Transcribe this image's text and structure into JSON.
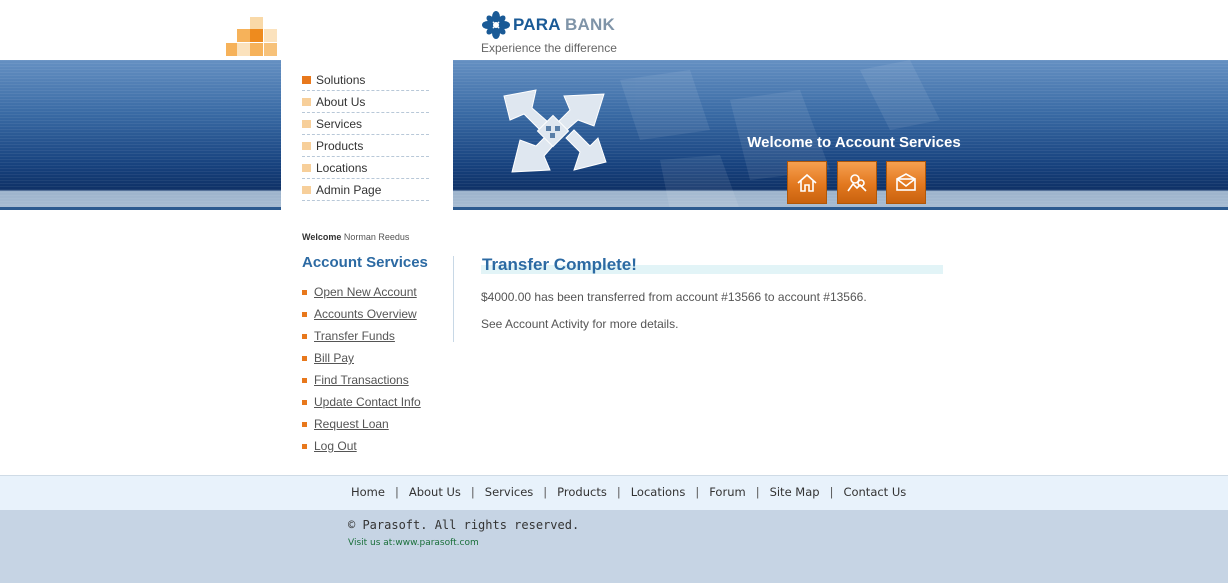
{
  "brand": {
    "name_part1": "PARA",
    "name_part2": "BANK",
    "caption": "Experience the difference"
  },
  "top_nav": {
    "items": [
      {
        "label": "Solutions"
      },
      {
        "label": "About Us"
      },
      {
        "label": "Services"
      },
      {
        "label": "Products"
      },
      {
        "label": "Locations"
      },
      {
        "label": "Admin Page"
      }
    ]
  },
  "hero": {
    "title": "Welcome to Account Services",
    "buttons": [
      {
        "icon": "home-icon"
      },
      {
        "icon": "about-icon"
      },
      {
        "icon": "contact-icon"
      }
    ]
  },
  "sidebar": {
    "welcome_label": "Welcome",
    "user_name": "Norman Reedus",
    "title": "Account Services",
    "links": [
      {
        "label": "Open New Account"
      },
      {
        "label": "Accounts Overview"
      },
      {
        "label": "Transfer Funds"
      },
      {
        "label": "Bill Pay"
      },
      {
        "label": "Find Transactions"
      },
      {
        "label": "Update Contact Info"
      },
      {
        "label": "Request Loan"
      },
      {
        "label": "Log Out"
      }
    ]
  },
  "main": {
    "title": "Transfer Complete!",
    "message_amount": "$4000.00",
    "message_middle": " has been transferred from account #",
    "from_account": "13566",
    "message_to": " to account #",
    "to_account": "13566",
    "message_end": ".",
    "activity_note": "See Account Activity for more details."
  },
  "footer": {
    "links": [
      {
        "label": "Home"
      },
      {
        "label": "About Us"
      },
      {
        "label": "Services"
      },
      {
        "label": "Products"
      },
      {
        "label": "Locations"
      },
      {
        "label": "Forum"
      },
      {
        "label": "Site Map"
      },
      {
        "label": "Contact Us"
      }
    ],
    "separator": "|",
    "copyright": "© Parasoft. All rights reserved.",
    "visit_label": "Visit us at:",
    "visit_url": "www.parasoft.com"
  },
  "colors": {
    "accent": "#e8781c",
    "brand_blue": "#2c6aa3",
    "header_blue": "#17427e"
  }
}
